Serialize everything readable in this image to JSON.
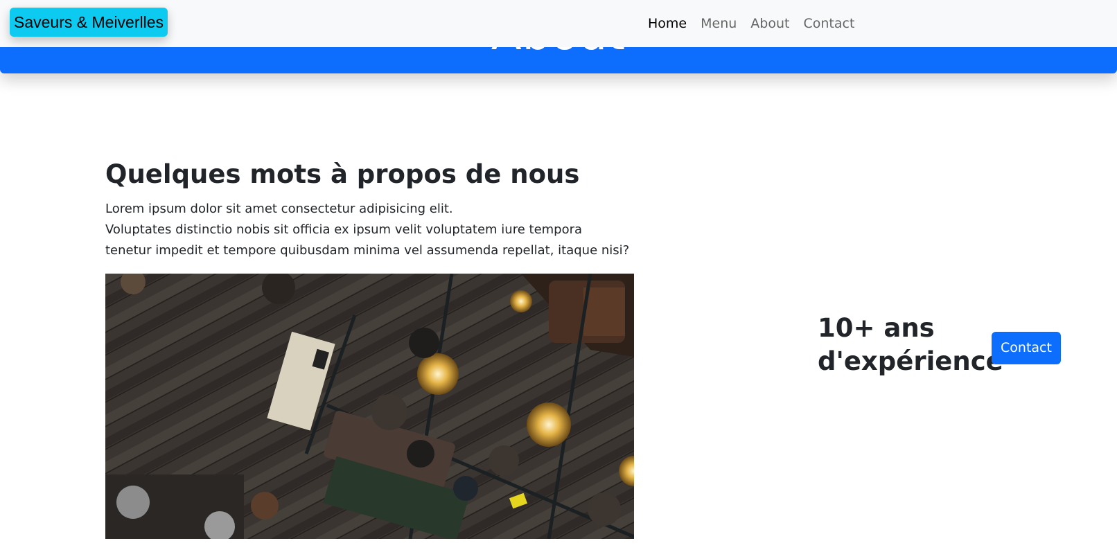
{
  "hero": {
    "title": "About"
  },
  "navbar": {
    "brand": "Saveurs & Meiverlles",
    "links": [
      {
        "label": "Home",
        "active": true
      },
      {
        "label": "Menu",
        "active": false
      },
      {
        "label": "About",
        "active": false
      },
      {
        "label": "Contact",
        "active": false
      }
    ]
  },
  "about": {
    "heading": "Quelques mots à propos de nous",
    "text_lines": [
      "Lorem ipsum dolor sit amet consectetur adipisicing elit.",
      "Voluptates distinctio nobis sit officia ex ipsum velit voluptatem iure tempora",
      "tenetur impedit et tempore quibusdam minima vel assumenda repellat, itaque nisi?"
    ]
  },
  "experience": {
    "line1": "10+ ans",
    "line2": "d'expérience"
  },
  "cta": {
    "label": "Contact"
  },
  "colors": {
    "primary": "#0d6efd",
    "brand_bg": "#0dcaf0",
    "navbar_bg": "#f8f9fa",
    "text": "#212529"
  }
}
